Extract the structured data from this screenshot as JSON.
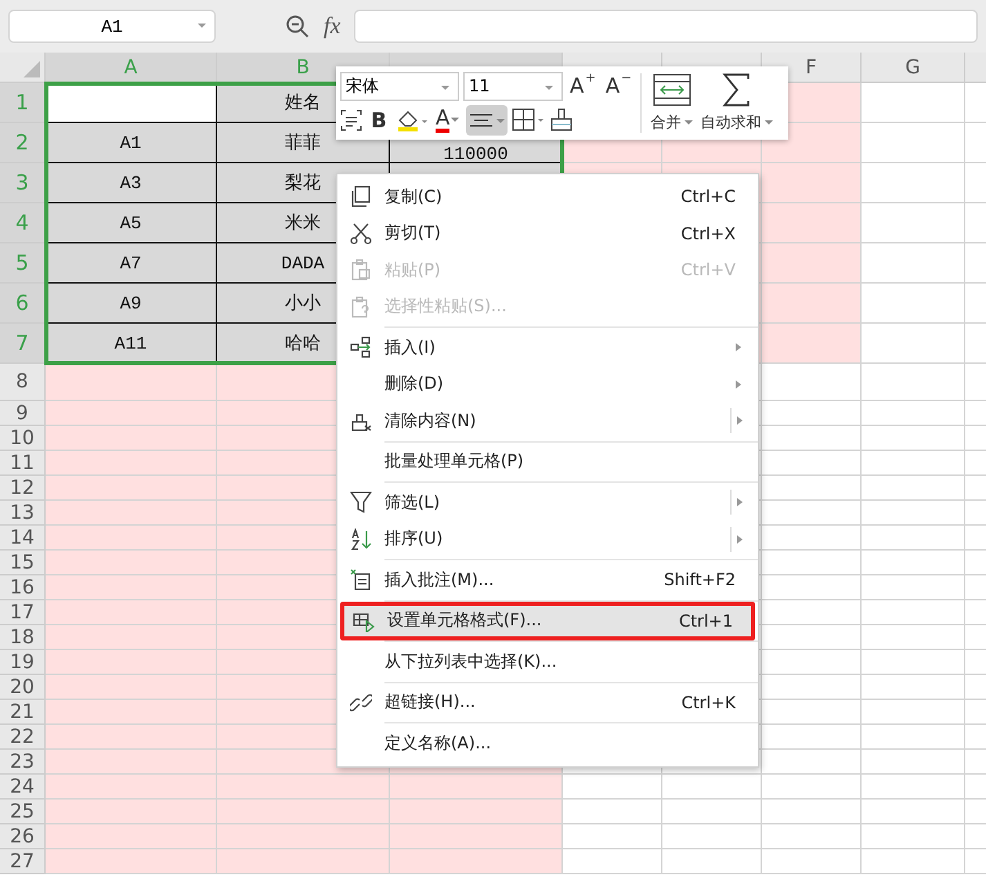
{
  "formula_bar": {
    "name_box": "A1",
    "fx": "fx"
  },
  "columns": [
    {
      "label": "A",
      "selected": true
    },
    {
      "label": "B",
      "selected": true
    },
    {
      "selected": true
    },
    {
      "selected": false
    },
    {
      "selected": false
    },
    {
      "label": "F",
      "selected": false
    },
    {
      "label": "G",
      "selected": false
    }
  ],
  "rows": [
    {
      "header": "1",
      "selected": true,
      "cells": [
        null,
        "姓名"
      ]
    },
    {
      "header": "2",
      "selected": true,
      "cells": [
        "A1",
        "菲菲",
        "110000"
      ]
    },
    {
      "header": "3",
      "selected": true,
      "cells": [
        "A3",
        "梨花"
      ]
    },
    {
      "header": "4",
      "selected": true,
      "cells": [
        "A5",
        "米米"
      ]
    },
    {
      "header": "5",
      "selected": true,
      "cells": [
        "A7",
        "DADA"
      ]
    },
    {
      "header": "6",
      "selected": true,
      "cells": [
        "A9",
        "小小"
      ]
    },
    {
      "header": "7",
      "selected": true,
      "cells": [
        "A11",
        "哈哈"
      ]
    },
    {
      "header": "8",
      "selected": false
    },
    {
      "header": "9",
      "selected": false
    },
    {
      "header": "10",
      "selected": false
    },
    {
      "header": "11",
      "selected": false
    },
    {
      "header": "12",
      "selected": false
    },
    {
      "header": "13",
      "selected": false
    },
    {
      "header": "14",
      "selected": false
    },
    {
      "header": "15",
      "selected": false
    },
    {
      "header": "16",
      "selected": false
    },
    {
      "header": "17",
      "selected": false
    },
    {
      "header": "18",
      "selected": false
    },
    {
      "header": "19",
      "selected": false
    },
    {
      "header": "20",
      "selected": false
    },
    {
      "header": "21",
      "selected": false
    },
    {
      "header": "22",
      "selected": false
    },
    {
      "header": "23",
      "selected": false
    },
    {
      "header": "24",
      "selected": false
    },
    {
      "header": "25",
      "selected": false
    },
    {
      "header": "26",
      "selected": false
    },
    {
      "header": "27",
      "selected": false
    }
  ],
  "mini_toolbar": {
    "font": "宋体",
    "size": "11",
    "grow": "A",
    "grow_sign": "+",
    "shrink": "A",
    "shrink_sign": "−",
    "bold": "B",
    "font_color": "A",
    "align_pressed": true,
    "merge": "合并",
    "autosum": "自动求和"
  },
  "context_menu": {
    "groups": [
      [
        {
          "label": "复制(C)",
          "shortcut": "Ctrl+C",
          "disabled": false,
          "submenu": false,
          "selected": false
        },
        {
          "label": "剪切(T)",
          "shortcut": "Ctrl+X",
          "disabled": false,
          "submenu": false,
          "selected": false
        },
        {
          "label": "粘贴(P)",
          "shortcut": "Ctrl+V",
          "disabled": true,
          "submenu": false,
          "selected": false
        },
        {
          "label": "选择性粘贴(S)...",
          "disabled": true,
          "submenu": false,
          "selected": false
        }
      ],
      [
        {
          "label": "插入(I)",
          "disabled": false,
          "submenu": true,
          "split": false,
          "selected": false
        },
        {
          "label": "删除(D)",
          "disabled": false,
          "submenu": true,
          "split": false,
          "selected": false
        },
        {
          "label": "清除内容(N)",
          "disabled": false,
          "submenu": true,
          "split": true,
          "selected": false
        }
      ],
      [
        {
          "label": "批量处理单元格(P)",
          "disabled": false,
          "submenu": false,
          "selected": false
        }
      ],
      [
        {
          "label": "筛选(L)",
          "disabled": false,
          "submenu": true,
          "split": true,
          "selected": false
        },
        {
          "label": "排序(U)",
          "disabled": false,
          "submenu": true,
          "split": true,
          "selected": false
        }
      ],
      [
        {
          "label": "插入批注(M)...",
          "shortcut": "Shift+F2",
          "disabled": false,
          "submenu": false,
          "selected": false
        }
      ],
      [
        {
          "label": "设置单元格格式(F)...",
          "shortcut": "Ctrl+1",
          "disabled": false,
          "submenu": false,
          "selected": true
        }
      ],
      [
        {
          "label": "从下拉列表中选择(K)...",
          "disabled": false,
          "submenu": false,
          "selected": false
        }
      ],
      [
        {
          "label": "超链接(H)...",
          "shortcut": "Ctrl+K",
          "disabled": false,
          "submenu": false,
          "selected": false
        }
      ],
      [
        {
          "label": "定义名称(A)...",
          "disabled": false,
          "submenu": false,
          "selected": false
        }
      ]
    ]
  }
}
